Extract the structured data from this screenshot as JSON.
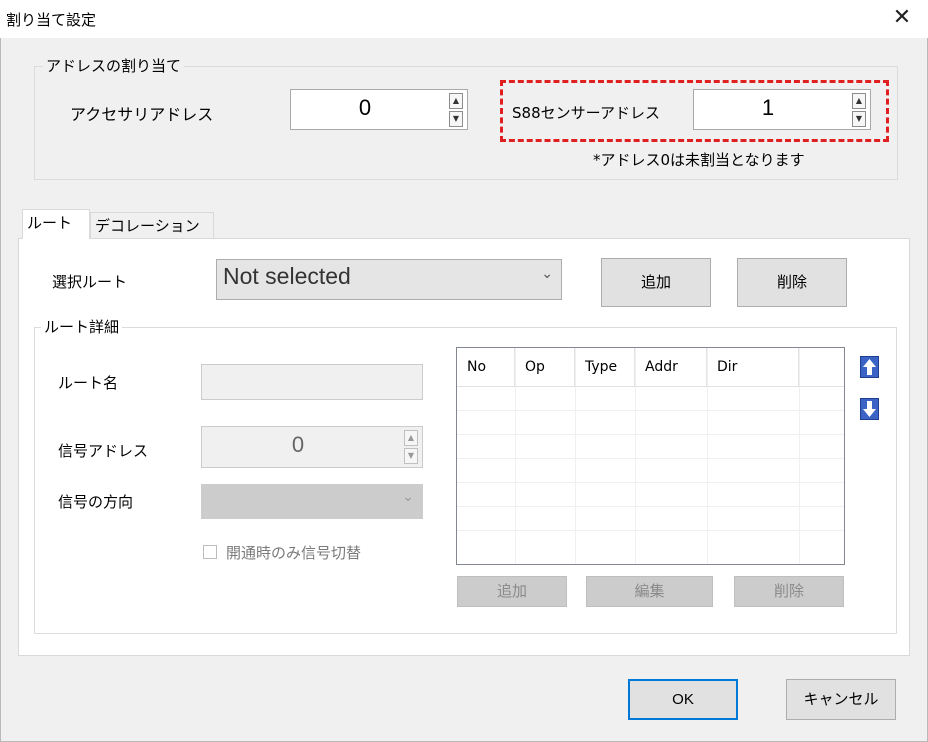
{
  "window": {
    "title": "割り当て設定",
    "close_glyph": "✕"
  },
  "address_group": {
    "label": "アドレスの割り当て",
    "accessory_label": "アクセサリアドレス",
    "accessory_value": "0",
    "s88_label": "S88センサーアドレス",
    "s88_value": "1",
    "note": "*アドレス0は未割当となります"
  },
  "tabs": [
    {
      "label": "ルート",
      "active": true
    },
    {
      "label": "デコレーション",
      "active": false
    }
  ],
  "route": {
    "select_label": "選択ルート",
    "select_value": "Not selected",
    "add_label": "追加",
    "delete_label": "削除"
  },
  "detail": {
    "group_label": "ルート詳細",
    "name_label": "ルート名",
    "name_value": "",
    "signal_addr_label": "信号アドレス",
    "signal_addr_value": "0",
    "signal_dir_label": "信号の方向",
    "signal_dir_value": "",
    "checkbox_label": "開通時のみ信号切替",
    "checkbox_checked": false,
    "table_columns": [
      "No",
      "Op",
      "Type",
      "Addr",
      "Dir"
    ],
    "table_add_label": "追加",
    "table_edit_label": "編集",
    "table_delete_label": "削除"
  },
  "footer": {
    "ok_label": "OK",
    "cancel_label": "キャンセル"
  },
  "colors": {
    "highlight": "#e02020",
    "accent": "#0078d7",
    "move_icon": "#3b63c5"
  }
}
